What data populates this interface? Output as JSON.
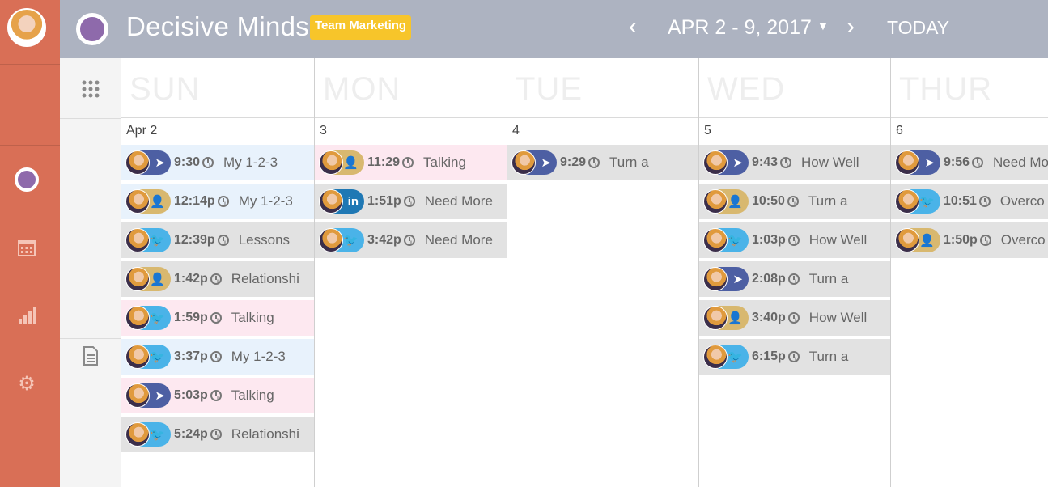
{
  "brand": {
    "name": "Decisive Minds",
    "team": "Team Marketing"
  },
  "nav": {
    "range": "APR 2 - 9, 2017",
    "prev_icon": "chevron-left-icon",
    "next_icon": "chevron-right-icon",
    "today": "TODAY"
  },
  "sidebar": {
    "icons": [
      "circle-icon",
      "calendar-icon",
      "bar-chart-icon",
      "gear-icon"
    ]
  },
  "colors": {
    "rail": "#d96f56",
    "header": "#adb3c1",
    "brand": "#8e6aab",
    "badge": "#f7c52a"
  },
  "days": [
    {
      "name": "SUN",
      "num": "Apr 2",
      "events": [
        {
          "time": "9:30",
          "title": "My 1-2-3",
          "net": "fb",
          "bg": "blue"
        },
        {
          "time": "12:14p",
          "title": "My 1-2-3",
          "net": "gp",
          "bg": "blue"
        },
        {
          "time": "12:39p",
          "title": "Lessons",
          "net": "tw",
          "bg": "gray"
        },
        {
          "time": "1:42p",
          "title": "Relationshi",
          "net": "gp",
          "bg": "gray"
        },
        {
          "time": "1:59p",
          "title": "Talking",
          "net": "tw",
          "bg": "pink"
        },
        {
          "time": "3:37p",
          "title": "My 1-2-3",
          "net": "tw",
          "bg": "blue"
        },
        {
          "time": "5:03p",
          "title": "Talking",
          "net": "fb",
          "bg": "pink"
        },
        {
          "time": "5:24p",
          "title": "Relationshi",
          "net": "tw",
          "bg": "gray"
        }
      ]
    },
    {
      "name": "MON",
      "num": "3",
      "events": [
        {
          "time": "11:29",
          "title": "Talking",
          "net": "gp",
          "bg": "pink"
        },
        {
          "time": "1:51p",
          "title": "Need More",
          "net": "li",
          "bg": "gray"
        },
        {
          "time": "3:42p",
          "title": "Need More",
          "net": "tw",
          "bg": "gray"
        }
      ]
    },
    {
      "name": "TUE",
      "num": "4",
      "events": [
        {
          "time": "9:29",
          "title": "Turn a",
          "net": "fb",
          "bg": "gray"
        }
      ]
    },
    {
      "name": "WED",
      "num": "5",
      "events": [
        {
          "time": "9:43",
          "title": "How Well",
          "net": "fb",
          "bg": "gray"
        },
        {
          "time": "10:50",
          "title": "Turn a",
          "net": "gp",
          "bg": "gray"
        },
        {
          "time": "1:03p",
          "title": "How Well",
          "net": "tw",
          "bg": "gray"
        },
        {
          "time": "2:08p",
          "title": "Turn a",
          "net": "fb",
          "bg": "gray"
        },
        {
          "time": "3:40p",
          "title": "How Well",
          "net": "gp",
          "bg": "gray"
        },
        {
          "time": "6:15p",
          "title": "Turn a",
          "net": "tw",
          "bg": "gray"
        }
      ]
    },
    {
      "name": "THUR",
      "num": "6",
      "events": [
        {
          "time": "9:56",
          "title": "Need Mo",
          "net": "fb",
          "bg": "gray"
        },
        {
          "time": "10:51",
          "title": "Overco",
          "net": "tw",
          "bg": "gray"
        },
        {
          "time": "1:50p",
          "title": "Overco",
          "net": "gp",
          "bg": "gray"
        }
      ]
    }
  ]
}
